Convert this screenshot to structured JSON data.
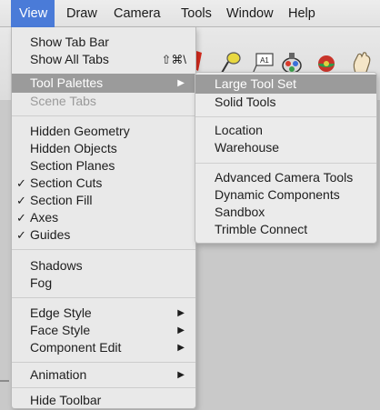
{
  "menubar": {
    "items": [
      "View",
      "Draw",
      "Camera",
      "Tools",
      "Window",
      "Help"
    ],
    "active": "View"
  },
  "toolbar": {
    "icons": [
      "red-pencil-icon",
      "tape-measure-icon",
      "text-label-icon",
      "paint-bucket-icon",
      "orbit-icon",
      "pan-hand-icon"
    ],
    "text_icon_label": "A1"
  },
  "view_menu": {
    "items": [
      {
        "label": "Show Tab Bar"
      },
      {
        "label": "Show All Tabs",
        "shortcut": "⇧⌘\\"
      },
      {
        "label": "Tool Palettes",
        "submenu": true,
        "highlighted": true
      },
      {
        "label": "Scene Tabs",
        "disabled": true
      },
      {
        "label": "Hidden Geometry"
      },
      {
        "label": "Hidden Objects"
      },
      {
        "label": "Section Planes"
      },
      {
        "label": "Section Cuts",
        "checked": true
      },
      {
        "label": "Section Fill",
        "checked": true
      },
      {
        "label": "Axes",
        "checked": true
      },
      {
        "label": "Guides",
        "checked": true
      },
      {
        "label": "Shadows"
      },
      {
        "label": "Fog"
      },
      {
        "label": "Edge Style",
        "submenu": true
      },
      {
        "label": "Face Style",
        "submenu": true
      },
      {
        "label": "Component Edit",
        "submenu": true
      },
      {
        "label": "Animation",
        "submenu": true
      },
      {
        "label": "Hide Toolbar"
      }
    ],
    "check_glyph": "✓",
    "arrow_glyph": "▶"
  },
  "tool_palettes_submenu": {
    "items": [
      {
        "label": "Large Tool Set",
        "highlighted": true
      },
      {
        "label": "Solid Tools"
      },
      {
        "label": "Location"
      },
      {
        "label": "Warehouse"
      },
      {
        "label": "Advanced Camera Tools"
      },
      {
        "label": "Dynamic Components"
      },
      {
        "label": "Sandbox"
      },
      {
        "label": "Trimble Connect"
      }
    ]
  }
}
